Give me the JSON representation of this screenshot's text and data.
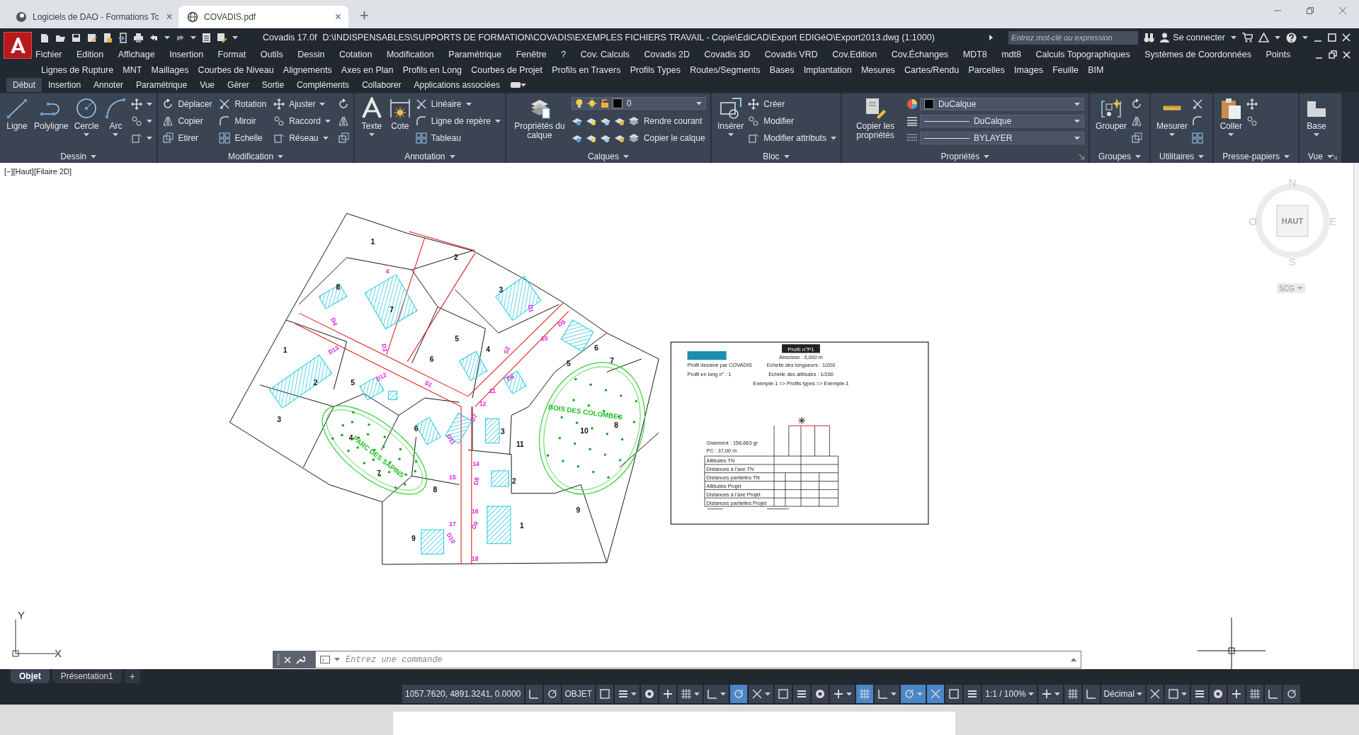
{
  "browser_tabs": [
    {
      "title": "Logiciels de DAO - Formations Tc",
      "selected": false,
      "close": "×"
    },
    {
      "title": "COVADIS.pdf",
      "selected": true,
      "close": "×"
    }
  ],
  "new_tab": "+",
  "title_bar": {
    "app": "Covadis 17.0f",
    "path": "D:\\INDISPENSABLES\\SUPPORTS DE FORMATION\\COVADIS\\EXEMPLES FICHIERS TRAVAIL - Copie\\EdiCAD\\Export EDIGéO\\Export2013.dwg (1:1000)",
    "search_placeholder": "Entrez mot-clé ou expression",
    "sign_in": "Se connecter"
  },
  "menu_rows": [
    [
      "Fichier",
      "Edition",
      "Affichage",
      "Insertion",
      "Format",
      "Outils",
      "Dessin",
      "Cotation",
      "Modification",
      "Paramétrique",
      "Fenêtre",
      "?",
      "Cov. Calculs",
      "Covadis 2D",
      "Covadis 3D",
      "Covadis VRD",
      "Cov.Edition",
      "Cov.Échanges",
      "MDT8",
      "mdt8",
      "Calculs Topographiques",
      "Systèmes de Coordonnées",
      "Points"
    ],
    [
      "Lignes de Rupture",
      "MNT",
      "Maillages",
      "Courbes de Niveau",
      "Alignements",
      "Axes en Plan",
      "Profils en Long",
      "Courbes de Projet",
      "Profils en Travers",
      "Profils Types",
      "Routes/Segments",
      "Bases",
      "Implantation",
      "Mesures",
      "Cartes/Rendu",
      "Parcelles",
      "Images",
      "Feuille",
      "BIM"
    ]
  ],
  "ribbon_tabs": [
    {
      "label": "Début",
      "selected": true
    },
    {
      "label": "Insertion",
      "selected": false
    },
    {
      "label": "Annoter",
      "selected": false
    },
    {
      "label": "Paramétrique",
      "selected": false
    },
    {
      "label": "Vue",
      "selected": false
    },
    {
      "label": "Gérer",
      "selected": false
    },
    {
      "label": "Sortie",
      "selected": false
    },
    {
      "label": "Compléments",
      "selected": false
    },
    {
      "label": "Collaborer",
      "selected": false
    },
    {
      "label": "Applications associées",
      "selected": false
    }
  ],
  "ribbon_panels": [
    {
      "title": "Dessin",
      "tools": [
        {
          "kind": "large",
          "label": "Ligne"
        },
        {
          "kind": "large",
          "label": "Polyligne"
        },
        {
          "kind": "large",
          "label": "Cercle",
          "menu": true
        },
        {
          "kind": "large",
          "label": "Arc",
          "menu": true
        },
        {
          "kind": "icon",
          "menu": true
        },
        {
          "kind": "icon",
          "menu": true
        },
        {
          "kind": "icon",
          "menu": true
        }
      ]
    },
    {
      "title": "Modification",
      "tools": [
        {
          "kind": "small",
          "label": "Déplacer"
        },
        {
          "kind": "small",
          "label": "Copier"
        },
        {
          "kind": "small",
          "label": "Etirer"
        },
        {
          "kind": "small",
          "label": "Rotation"
        },
        {
          "kind": "small",
          "label": "Miroir"
        },
        {
          "kind": "small",
          "label": "Echelle"
        },
        {
          "kind": "small",
          "label": "Ajuster",
          "menu": true
        },
        {
          "kind": "small",
          "label": "Raccord",
          "menu": true
        },
        {
          "kind": "small",
          "label": "Réseau",
          "menu": true
        },
        {
          "kind": "icon"
        },
        {
          "kind": "icon"
        },
        {
          "kind": "icon"
        }
      ]
    },
    {
      "title": "Annotation",
      "tools": [
        {
          "kind": "large",
          "label": "Texte",
          "menu": true
        },
        {
          "kind": "large",
          "label": "Cote"
        },
        {
          "kind": "small",
          "label": "Linéaire",
          "menu": true
        },
        {
          "kind": "small",
          "label": "Ligne de repère",
          "menu": true
        },
        {
          "kind": "small",
          "label": "Tableau"
        }
      ]
    },
    {
      "title": "Calques",
      "tools": [
        {
          "kind": "large",
          "label": "Propriétés du calque"
        },
        {
          "kind": "layer_combo",
          "label": "0"
        },
        {
          "kind": "layer_small",
          "label": "Rendre courant"
        },
        {
          "kind": "layer_small",
          "label": "Copier le calque"
        }
      ]
    },
    {
      "title": "Bloc",
      "tools": [
        {
          "kind": "large",
          "label": "Insérer",
          "menu": true
        },
        {
          "kind": "small",
          "label": "Créer"
        },
        {
          "kind": "small",
          "label": "Modifier"
        },
        {
          "kind": "small",
          "label": "Modifier attributs",
          "menu": true
        }
      ]
    },
    {
      "title": "Propriétés",
      "launcher": true,
      "tools": [
        {
          "kind": "large",
          "label": "Copier les propriétés"
        },
        {
          "kind": "combo",
          "label": "DuCalque"
        },
        {
          "kind": "combo",
          "label": "DuCalque"
        },
        {
          "kind": "combo",
          "label": "BYLAYER"
        }
      ]
    },
    {
      "title": "Groupes",
      "tools": [
        {
          "kind": "large",
          "label": "Grouper"
        },
        {
          "kind": "icon"
        },
        {
          "kind": "icon"
        },
        {
          "kind": "icon"
        }
      ]
    },
    {
      "title": "Utilitaires",
      "tools": [
        {
          "kind": "large",
          "label": "Mesurer",
          "menu": true
        },
        {
          "kind": "icon"
        },
        {
          "kind": "icon"
        },
        {
          "kind": "icon"
        }
      ]
    },
    {
      "title": "Presse-papiers",
      "tools": [
        {
          "kind": "large",
          "label": "Coller",
          "menu": true
        },
        {
          "kind": "icon"
        },
        {
          "kind": "icon"
        }
      ]
    },
    {
      "title": "Vue",
      "launcher": true,
      "tools": [
        {
          "kind": "large",
          "label": "Base",
          "menu": true
        }
      ]
    }
  ],
  "drawing": {
    "view_label": "[−][Haut][Filaire 2D]",
    "parcel_labels": [
      "1",
      "2",
      "3",
      "8",
      "7",
      "5",
      "1",
      "6",
      "4",
      "2",
      "5",
      "3",
      "6",
      "4",
      "7",
      "8",
      "3",
      "11",
      "2",
      "5",
      "6",
      "7",
      "10",
      "8",
      "9",
      "9",
      "1"
    ],
    "zone_labels": [
      "BOIS DES COLOMBES",
      "PARC DES SAPINS"
    ],
    "road_labels": [
      "D5",
      "D4",
      "D13",
      "D3",
      "D12",
      "S1",
      "D7",
      "D6",
      "D11",
      "D8",
      "D9",
      "D10",
      "D1",
      "S2",
      "4",
      "10",
      "11",
      "12",
      "14",
      "15",
      "16",
      "17",
      "18"
    ]
  },
  "profile_sheet": {
    "title": "Profil n°P1",
    "lines": [
      "Profil dessiné par COVADIS",
      "Profil en long n° : 1",
      "Abscisse : 0,000 m",
      "Echelle des longueurs : 1/200",
      "Echelle des altitudes : 1/200",
      "Exemple-1 => Profils types => Exemple-1",
      "Gisement : 156,663 gr",
      "PC : 37,00 m"
    ],
    "table_rows": [
      "Altitudes TN",
      "Distances à l'axe TN",
      "Distances partielles TN",
      "Altitudes Projet",
      "Distances à l'axe Projet",
      "Distances partielles Projet"
    ]
  },
  "view_cube": {
    "top": "HAUT",
    "north": "N",
    "south": "S",
    "east": "E",
    "west": "O",
    "ucs": "SCG"
  },
  "ucs": {
    "x": "X",
    "y": "Y"
  },
  "command_line": {
    "placeholder": "Entrez une commande"
  },
  "layout_tabs": [
    {
      "label": "Objet",
      "selected": true
    },
    {
      "label": "Présentation1",
      "selected": false
    }
  ],
  "layout_add": "+",
  "status_items": [
    {
      "kind": "text",
      "label": "1057.7620, 4891.3241, 0.0000"
    },
    {
      "kind": "toggle",
      "on": false
    },
    {
      "kind": "toggle",
      "on": false
    },
    {
      "kind": "text",
      "label": "OBJET"
    },
    {
      "kind": "toggle",
      "on": false
    },
    {
      "kind": "toggle",
      "on": false,
      "menu": true
    },
    {
      "kind": "toggle",
      "on": false
    },
    {
      "kind": "toggle",
      "on": false
    },
    {
      "kind": "toggle",
      "on": false,
      "menu": true
    },
    {
      "kind": "toggle",
      "on": false,
      "menu": true
    },
    {
      "kind": "toggle",
      "on": true
    },
    {
      "kind": "toggle",
      "on": false,
      "menu": true
    },
    {
      "kind": "toggle",
      "on": false
    },
    {
      "kind": "toggle",
      "on": false
    },
    {
      "kind": "toggle",
      "on": false
    },
    {
      "kind": "toggle",
      "on": false,
      "menu": true
    },
    {
      "kind": "toggle",
      "on": true
    },
    {
      "kind": "toggle",
      "on": false,
      "menu": true
    },
    {
      "kind": "toggle",
      "on": true,
      "menu": true
    },
    {
      "kind": "toggle",
      "on": true
    },
    {
      "kind": "toggle",
      "on": false
    },
    {
      "kind": "toggle",
      "on": false
    },
    {
      "kind": "text",
      "label": "1:1 / 100%",
      "menu": true
    },
    {
      "kind": "toggle",
      "on": false,
      "menu": true
    },
    {
      "kind": "toggle",
      "on": false
    },
    {
      "kind": "toggle",
      "on": false
    },
    {
      "kind": "text",
      "label": "Décimal",
      "menu": true
    },
    {
      "kind": "toggle",
      "on": false
    },
    {
      "kind": "toggle",
      "on": false,
      "menu": true
    },
    {
      "kind": "toggle",
      "on": false
    },
    {
      "kind": "toggle",
      "on": false
    },
    {
      "kind": "toggle",
      "on": false
    },
    {
      "kind": "toggle",
      "on": false
    },
    {
      "kind": "toggle",
      "on": false
    },
    {
      "kind": "toggle",
      "on": false
    }
  ]
}
